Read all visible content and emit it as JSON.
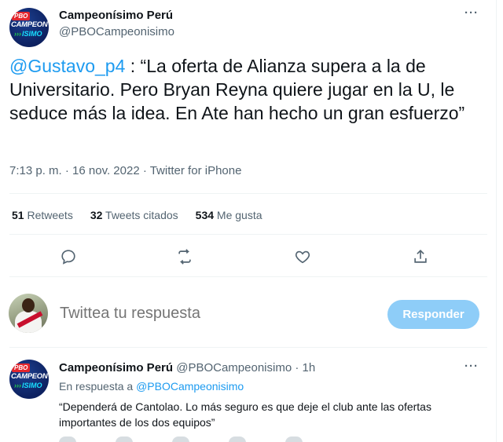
{
  "tweet": {
    "author": {
      "name": "Campeonísimo Perú",
      "handle": "@PBOCampeonisimo",
      "avatar": {
        "badge": "PBO",
        "line1": "CAMPEON",
        "line2": "ISIMO"
      }
    },
    "more_icon": "···",
    "text_mention": "@Gustavo_p4",
    "text_body": " : “La oferta de Alianza supera a la de Universitario. Pero Bryan Reyna quiere jugar en la U, le seduce más la idea. En Ate han hecho un gran esfuerzo”",
    "meta": "7:13 p. m. · 16 nov. 2022 · Twitter for iPhone",
    "stats": {
      "retweets_count": "51",
      "retweets_label": " Retweets",
      "quotes_count": "32",
      "quotes_label": " Tweets citados",
      "likes_count": "534",
      "likes_label": " Me gusta"
    },
    "actions": [
      "reply-icon",
      "retweet-icon",
      "like-icon",
      "share-icon"
    ]
  },
  "composer": {
    "placeholder": "Twittea tu respuesta",
    "button_label": "Responder"
  },
  "reply": {
    "author": {
      "name": "Campeonísimo Perú",
      "handle": "@PBOCampeonisimo",
      "avatar": {
        "badge": "PBO",
        "line1": "CAMPEON",
        "line2": "ISIMO"
      }
    },
    "separator": " · ",
    "time": "1h",
    "context_prefix": "En respuesta a ",
    "context_mention": "@PBOCampeonisimo",
    "text": "“Dependerá de Cantolao. Lo más seguro es que deje el club ante las ofertas importantes de los dos equipos”",
    "more_icon": "···"
  },
  "colors": {
    "accent": "#1d9bf0",
    "button_disabled": "#8ecdf8",
    "secondary_text": "#536471"
  }
}
